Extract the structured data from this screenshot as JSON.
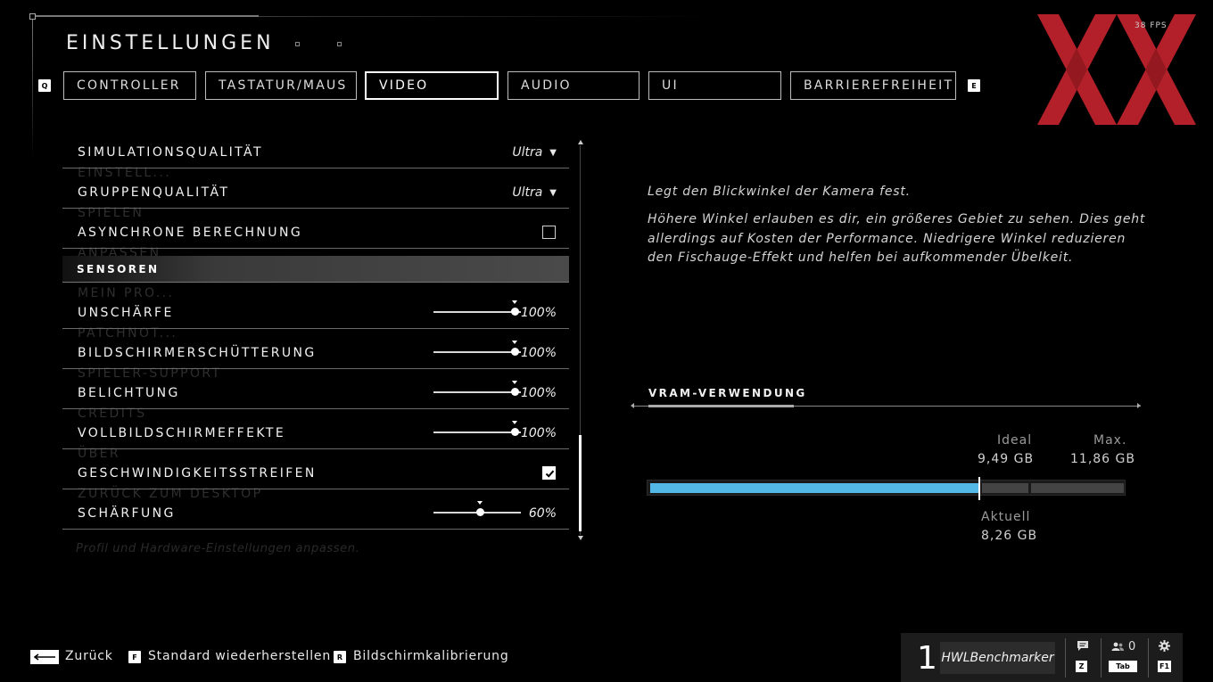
{
  "header": {
    "title": "EINSTELLUNGEN",
    "fps": "38 FPS",
    "left_key": "Q",
    "right_key": "E"
  },
  "tabs": [
    {
      "label": "CONTROLLER",
      "active": false
    },
    {
      "label": "TASTATUR/MAUS",
      "active": false
    },
    {
      "label": "VIDEO",
      "active": true
    },
    {
      "label": "AUDIO",
      "active": false
    },
    {
      "label": "UI",
      "active": false
    },
    {
      "label": "BARRIEREFREIHEIT",
      "active": false
    }
  ],
  "ghost_menu": {
    "items": [
      "EINSTELL...",
      "SPIELEN",
      "ANPASSEN",
      "MEIN PRO...",
      "PATCHNOT...",
      "SPIELER-SUPPORT",
      "CREDITS",
      "ÜBER",
      "ZURÜCK ZUM DESKTOP"
    ],
    "caption": "Profil und Hardware-Einstellungen anpassen."
  },
  "settings": {
    "rows": [
      {
        "label": "SIMULATIONSQUALITÄT",
        "type": "dropdown",
        "value": "Ultra"
      },
      {
        "label": "GRUPPENQUALITÄT",
        "type": "dropdown",
        "value": "Ultra"
      },
      {
        "label": "ASYNCHRONE BERECHNUNG",
        "type": "checkbox",
        "checked": false
      }
    ],
    "section": "SENSOREN",
    "sensor_rows": [
      {
        "label": "UNSCHÄRFE",
        "type": "slider",
        "value": "100%",
        "fraction": 1.0
      },
      {
        "label": "BILDSCHIRMERSCHÜTTERUNG",
        "type": "slider",
        "value": "100%",
        "fraction": 1.0
      },
      {
        "label": "BELICHTUNG",
        "type": "slider",
        "value": "100%",
        "fraction": 1.0
      },
      {
        "label": "VOLLBILDSCHIRMEFFEKTE",
        "type": "slider",
        "value": "100%",
        "fraction": 1.0
      },
      {
        "label": "GESCHWINDIGKEITSSTREIFEN",
        "type": "checkbox",
        "checked": true
      },
      {
        "label": "SCHÄRFUNG",
        "type": "slider",
        "value": "60%",
        "fraction": 0.6
      }
    ]
  },
  "description": {
    "line1": "Legt den Blickwinkel der Kamera fest.",
    "line2": "Höhere Winkel erlauben es dir, ein größeres Gebiet zu sehen. Dies geht allerdings auf Kosten der Performance. Niedrigere Winkel reduzieren den Fischauge-Effekt und helfen bei aufkommender Übelkeit."
  },
  "vram": {
    "title": "VRAM-VERWENDUNG",
    "ideal_label": "Ideal",
    "ideal_value": "9,49 GB",
    "max_label": "Max.",
    "max_value": "11,86 GB",
    "current_label": "Aktuell",
    "current_value": "8,26 GB",
    "current_gb": 8.26,
    "ideal_gb": 9.49,
    "max_gb": 11.86,
    "fill_color": "#53b8e6"
  },
  "footer": {
    "back_label": "Zurück",
    "reset_key": "F",
    "reset_label": "Standard wiederherstellen",
    "calib_key": "R",
    "calib_label": "Bildschirmkalibrierung"
  },
  "profile": {
    "rank": "1",
    "name": "HWLBenchmarker",
    "chat_key": "Z",
    "friends_count": "0",
    "friends_key": "Tab",
    "settings_key": "F1"
  },
  "colors": {
    "logo_red": "#b3202a",
    "accent_blue": "#53b8e6"
  }
}
